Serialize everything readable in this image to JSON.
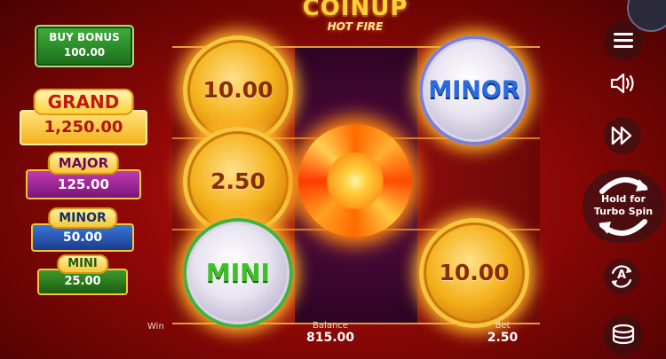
{
  "logo": {
    "main": "COINUP",
    "sub": "HOT FIRE"
  },
  "buy_bonus": {
    "label": "BUY BONUS",
    "price": "100.00"
  },
  "jackpots": {
    "grand": {
      "label": "GRAND",
      "value": "1,250.00"
    },
    "major": {
      "label": "MAJOR",
      "value": "125.00"
    },
    "minor": {
      "label": "MINOR",
      "value": "50.00"
    },
    "mini": {
      "label": "MINI",
      "value": "25.00"
    }
  },
  "reels": {
    "coin_r1c1": "10.00",
    "coin_r1c3": "MINOR",
    "coin_r2c1": "2.50",
    "coin_r3c1": "MINI",
    "coin_r3c3": "10.00"
  },
  "footer": {
    "win_label": "Win",
    "balance_label": "Balance",
    "balance_value": "815.00",
    "bet_label": "Bet",
    "bet_value": "2.50"
  },
  "controls": {
    "spin_line1": "Hold for",
    "spin_line2": "Turbo Spin",
    "auto_letter": "A"
  },
  "colors": {
    "background": "#8e0806",
    "gold": "#f4b21c",
    "minor_blue": "#2a6be0",
    "mini_green": "#3fbf2a"
  }
}
